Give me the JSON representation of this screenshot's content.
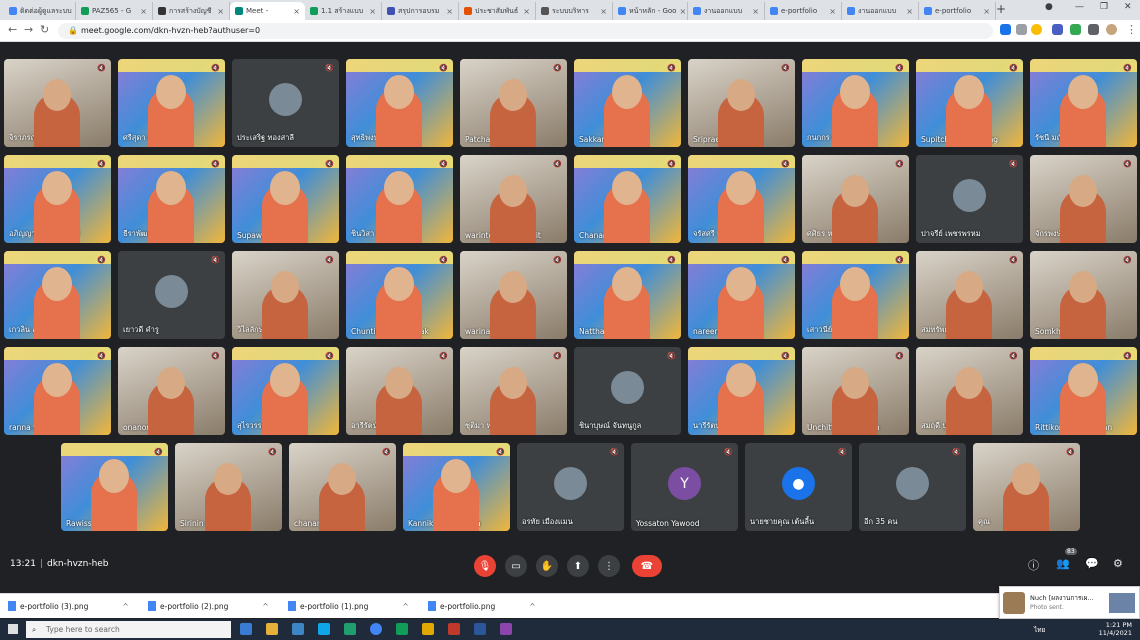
{
  "browser": {
    "tabs": [
      {
        "label": "ติดต่อผู้ดูแลระบบ",
        "color": "#4285f4"
      },
      {
        "label": "PAZ565 - G",
        "color": "#0f9d58"
      },
      {
        "label": "การสร้างบัญชี",
        "color": "#333333"
      },
      {
        "label": "Meet -",
        "color": "#00897b",
        "active": true
      },
      {
        "label": "1.1 สร้างแบบ",
        "color": "#0f9d58"
      },
      {
        "label": "สรุปการอบรม",
        "color": "#3f51b5"
      },
      {
        "label": "ประชาสัมพันธ์",
        "color": "#e65100"
      },
      {
        "label": "ระบบบริหาร",
        "color": "#555555"
      },
      {
        "label": "หน้าหลัก - Goo",
        "color": "#4285f4"
      },
      {
        "label": "งานออกแบบ",
        "color": "#4285f4"
      },
      {
        "label": "e-portfolio",
        "color": "#4285f4"
      },
      {
        "label": "งานออกแบบ",
        "color": "#4285f4"
      },
      {
        "label": "e-portfolio",
        "color": "#4285f4"
      }
    ],
    "new_tab": "+",
    "url": "meet.google.com/dkn-hvzn-heb?authuser=0"
  },
  "participants": [
    {
      "name": "จิราภรณ์ สุวรรณ",
      "style": "room"
    },
    {
      "name": "ศรีสุดา แสงใจดี",
      "style": "cam"
    },
    {
      "name": "ประเสริฐ ทองสาลี",
      "style": "dark"
    },
    {
      "name": "สุทธิพงษ์ by ทุ่งสง",
      "style": "cam"
    },
    {
      "name": "Patcharee Patthu",
      "style": "room"
    },
    {
      "name": "Sakkarin Riadbon",
      "style": "cam"
    },
    {
      "name": "Sriprae Wichaidit",
      "style": "room"
    },
    {
      "name": "กนกกร พรหมรักษา",
      "style": "cam"
    },
    {
      "name": "Supitchaya Rakdeng",
      "style": "cam"
    },
    {
      "name": "รัชนี มณีรัตนทร",
      "style": "cam"
    },
    {
      "name": "อภิญญา กิจสังเคราะห์",
      "style": "cam"
    },
    {
      "name": "ธีราพัฒน์ ใจสนอง",
      "style": "cam"
    },
    {
      "name": "Supawadee Samer",
      "style": "cam"
    },
    {
      "name": "ชินวิสา พึ่งแย้ม",
      "style": "cam"
    },
    {
      "name": "warinton jantarachit",
      "style": "room"
    },
    {
      "name": "Chananya unnwo",
      "style": "cam"
    },
    {
      "name": "จรัสศรี เพชรแก้ว",
      "style": "cam"
    },
    {
      "name": "ศศิธร หนูมณี",
      "style": "room"
    },
    {
      "name": "ปาจรีย์ เพชรพรหม",
      "style": "dark"
    },
    {
      "name": "จักรพงษ์ อุไรรัตน์",
      "style": "room"
    },
    {
      "name": "เกวลิน สุวรรณา",
      "style": "cam"
    },
    {
      "name": "เยาวดี คำรู",
      "style": "dark"
    },
    {
      "name": "วิไลลักษณ์ ทิพย์ปาน",
      "style": "room"
    },
    {
      "name": "Chuntima chuaipitak",
      "style": "cam"
    },
    {
      "name": "warinan Ongart",
      "style": "room"
    },
    {
      "name": "Nattha wongsa",
      "style": "cam"
    },
    {
      "name": "nareerat praditsan",
      "style": "cam"
    },
    {
      "name": "เสาวนีย์ จูแย้",
      "style": "cam"
    },
    {
      "name": "สมทรัพย์ หนูรักษ์",
      "style": "room"
    },
    {
      "name": "Somkhuan Panmo",
      "style": "room"
    },
    {
      "name": "ranna wichian",
      "style": "cam"
    },
    {
      "name": "onanong saelim",
      "style": "room"
    },
    {
      "name": "สุไรวรรณ ชูกุลสงฆ์",
      "style": "cam"
    },
    {
      "name": "อารีรัตน์ พูลสวัสดิ์",
      "style": "room"
    },
    {
      "name": "ชุติมา หมัดหลำ",
      "style": "room"
    },
    {
      "name": "ชินาบุษณ์ จันทนูกูล",
      "style": "dark"
    },
    {
      "name": "นารีรัตน์ อุไรสวัสดิ์",
      "style": "cam"
    },
    {
      "name": "Unchittha Ngoenph",
      "style": "room"
    },
    {
      "name": "สมฤดี บุญชู",
      "style": "room"
    },
    {
      "name": "Rittikorn Sangsichan",
      "style": "cam"
    },
    {
      "name": "Rawissara Sutti",
      "style": "cam"
    },
    {
      "name": "Sirinin Intharat",
      "style": "room"
    },
    {
      "name": "chananat samingc",
      "style": "room"
    },
    {
      "name": "Kannika Naktongka",
      "style": "cam"
    },
    {
      "name": "อรทัย เมืองแมน",
      "style": "dark"
    },
    {
      "name": "Yossaton Yawood",
      "style": "dark",
      "initial": "Y"
    },
    {
      "name": "นายชายคุณ เต้นลี้น",
      "style": "dark"
    },
    {
      "name": "อีก 35 คน",
      "style": "dark"
    },
    {
      "name": "คุณ",
      "style": "room"
    }
  ],
  "bottom": {
    "time": "13:21",
    "meeting_code": "dkn-hvzn-heb",
    "participant_count": "83"
  },
  "downloads": [
    "e-portfolio (3).png",
    "e-portfolio (2).png",
    "e-portfolio (1).png",
    "e-portfolio.png"
  ],
  "toast": {
    "title": "Nuch [ผลงานการเผ...",
    "subtitle": "Photo sent."
  },
  "taskbar": {
    "search_placeholder": "Type here to search",
    "lang": "ไทย",
    "clock_time": "1:21 PM",
    "clock_date": "11/4/2021"
  }
}
